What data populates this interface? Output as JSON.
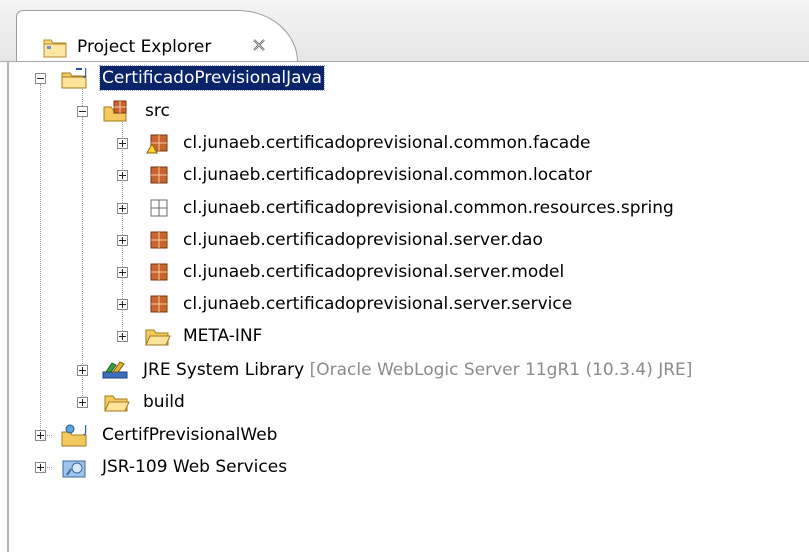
{
  "view": {
    "title": "Project Explorer",
    "icon": "folder-view-icon",
    "close_icon": "close-x-icon"
  },
  "tree": {
    "project1": {
      "label": "CertificadoPrevisionalJava",
      "icon": "java-project-icon",
      "selected": true,
      "expanded": true
    },
    "src": {
      "label": "src",
      "icon": "source-folder-icon",
      "expanded": true
    },
    "packages": [
      {
        "label": "cl.junaeb.certificadoprevisional.common.facade",
        "icon": "package-warning-icon"
      },
      {
        "label": "cl.junaeb.certificadoprevisional.common.locator",
        "icon": "package-icon"
      },
      {
        "label": "cl.junaeb.certificadoprevisional.common.resources.spring",
        "icon": "empty-package-icon"
      },
      {
        "label": "cl.junaeb.certificadoprevisional.server.dao",
        "icon": "package-icon"
      },
      {
        "label": "cl.junaeb.certificadoprevisional.server.model",
        "icon": "package-icon"
      },
      {
        "label": "cl.junaeb.certificadoprevisional.server.service",
        "icon": "package-icon"
      }
    ],
    "meta_inf": {
      "label": "META-INF",
      "icon": "folder-icon"
    },
    "jre": {
      "label": "JRE System Library",
      "decoration": "[Oracle WebLogic Server 11gR1 (10.3.4) JRE]",
      "icon": "library-icon"
    },
    "build": {
      "label": "build",
      "icon": "folder-icon"
    },
    "project2": {
      "label": "CertifPrevisionalWeb",
      "icon": "web-project-icon"
    },
    "project3": {
      "label": "JSR-109 Web Services",
      "icon": "web-services-icon"
    }
  },
  "colors": {
    "selection": "#0a246a",
    "package_brown": "#b4562c",
    "folder_yellow": "#f2c24e",
    "decoration_gray": "#8b8b8b"
  }
}
